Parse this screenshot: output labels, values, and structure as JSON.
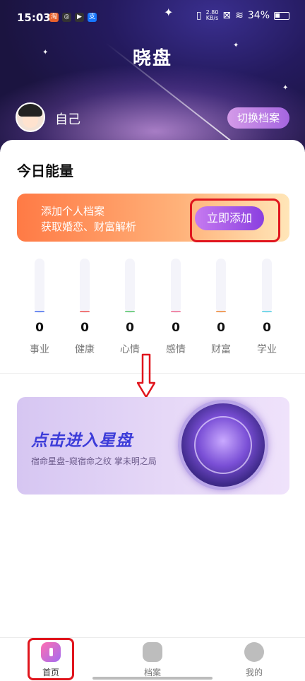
{
  "status_bar": {
    "time": "15:03",
    "net_speed_value": "2.80",
    "net_speed_unit": "KB/s",
    "battery_percent": "34%"
  },
  "header": {
    "app_title": "晓盘",
    "profile_name": "自己",
    "switch_button_label": "切换档案"
  },
  "energy": {
    "section_title": "今日能量",
    "promo_line1": "添加个人档案",
    "promo_line2": "获取婚恋、财富解析",
    "promo_button_label": "立即添加",
    "meters": [
      {
        "label": "事业",
        "value": "0",
        "color": "#6f8df0"
      },
      {
        "label": "健康",
        "value": "0",
        "color": "#f07878"
      },
      {
        "label": "心情",
        "value": "0",
        "color": "#78d088"
      },
      {
        "label": "感情",
        "value": "0",
        "color": "#f08aa8"
      },
      {
        "label": "财富",
        "value": "0",
        "color": "#f0a060"
      },
      {
        "label": "学业",
        "value": "0",
        "color": "#78d8e8"
      }
    ]
  },
  "banner": {
    "title": "点击进入星盘",
    "subtitle": "宿命星盘–窥宿命之纹 掌未明之局"
  },
  "bottom_nav": {
    "items": [
      {
        "label": "首页"
      },
      {
        "label": "档案"
      },
      {
        "label": "我的"
      }
    ]
  },
  "colors": {
    "accent_purple": "#9b4fe6",
    "annotation_red": "#e0151d"
  }
}
